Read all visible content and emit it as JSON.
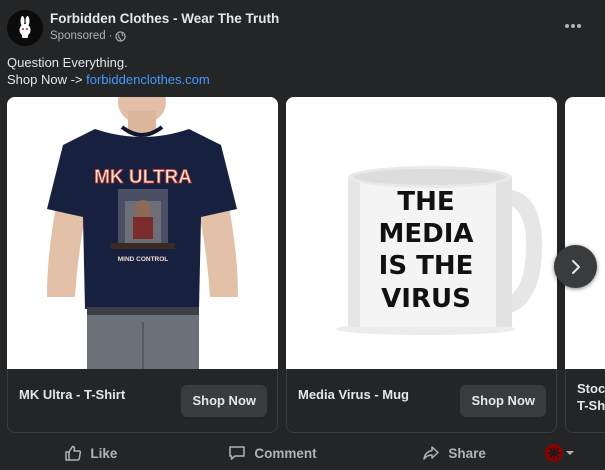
{
  "post": {
    "page_name": "Forbidden Clothes - Wear The Truth",
    "sponsored_label": "Sponsored",
    "separator": "·",
    "caption_line1": "Question Everything.",
    "caption_line2_prefix": "Shop Now -> ",
    "caption_link": "forbiddenclothes.com"
  },
  "carousel": {
    "cards": [
      {
        "title": "MK Ultra - T-Shirt",
        "button": "Shop Now",
        "image_text_top": "MK ULTRA",
        "image_text_bottom": "MIND CONTROL"
      },
      {
        "title": "Media Virus - Mug",
        "button": "Shop Now",
        "image_text": [
          "THE",
          "MEDIA",
          "IS THE",
          "VIRUS"
        ]
      },
      {
        "title_lines": [
          "Stoc",
          "T-Sh"
        ]
      }
    ]
  },
  "actions": {
    "like": "Like",
    "comment": "Comment",
    "share": "Share"
  },
  "colors": {
    "background": "#242526",
    "link": "#4599ff",
    "button": "#3a3b3c"
  }
}
